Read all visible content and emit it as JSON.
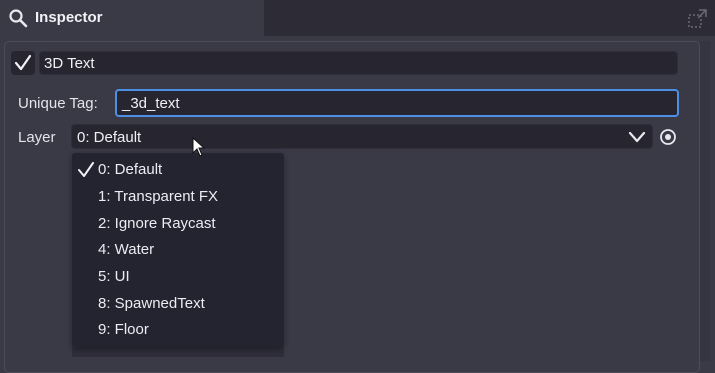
{
  "tab": {
    "title": "Inspector"
  },
  "object": {
    "name": "3D Text",
    "enabled": true
  },
  "unique_tag": {
    "label": "Unique Tag:",
    "value": "_3d_text"
  },
  "layer": {
    "label": "Layer",
    "selected": "0: Default",
    "options": [
      {
        "label": "0: Default",
        "checked": true
      },
      {
        "label": "1: Transparent FX",
        "checked": false
      },
      {
        "label": "2: Ignore Raycast",
        "checked": false
      },
      {
        "label": "4: Water",
        "checked": false
      },
      {
        "label": "5: UI",
        "checked": false
      },
      {
        "label": "8: SpawnedText",
        "checked": false
      },
      {
        "label": "9: Floor",
        "checked": false
      }
    ]
  },
  "colors": {
    "accent": "#4e8fe6",
    "panel": "#3a3946",
    "field": "#262530",
    "dropdown": "#242330"
  }
}
